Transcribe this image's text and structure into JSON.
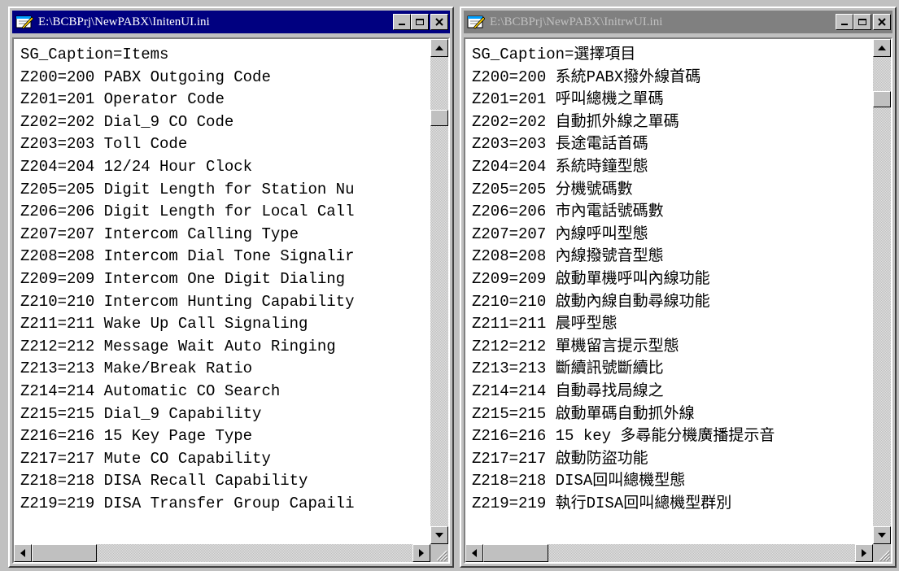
{
  "colors": {
    "active_title": "#000080",
    "inactive_title": "#808080",
    "face": "#c0c0c0"
  },
  "left_window": {
    "title": "E:\\BCBPrj\\NewPABX\\InitenUI.ini",
    "lines": [
      "SG_Caption=Items",
      "Z200=200 PABX Outgoing Code",
      "Z201=201 Operator Code",
      "Z202=202 Dial_9 CO Code",
      "Z203=203 Toll Code",
      "Z204=204 12/24 Hour Clock",
      "Z205=205 Digit Length for Station Nu",
      "Z206=206 Digit Length for Local Call",
      "Z207=207 Intercom Calling Type",
      "Z208=208 Intercom Dial Tone Signalir",
      "Z209=209 Intercom One Digit Dialing",
      "Z210=210 Intercom Hunting Capability",
      "Z211=211 Wake Up Call Signaling",
      "Z212=212 Message Wait Auto Ringing",
      "Z213=213 Make/Break Ratio",
      "Z214=214 Automatic CO Search",
      "Z215=215 Dial_9 Capability",
      "Z216=216 15 Key Page Type",
      "Z217=217 Mute CO Capability",
      "Z218=218 DISA Recall Capability",
      "Z219=219 DISA Transfer Group Capaili"
    ]
  },
  "right_window": {
    "title": "E:\\BCBPrj\\NewPABX\\InitrwUI.ini",
    "lines": [
      "SG_Caption=選擇項目",
      "Z200=200 系統PABX撥外線首碼",
      "Z201=201 呼叫總機之單碼",
      "Z202=202 自動抓外線之單碼",
      "Z203=203 長途電話首碼",
      "Z204=204 系統時鐘型態",
      "Z205=205 分機號碼數",
      "Z206=206 市內電話號碼數",
      "Z207=207 內線呼叫型態",
      "Z208=208 內線撥號音型態",
      "Z209=209 啟動單機呼叫內線功能",
      "Z210=210 啟動內線自動尋線功能",
      "Z211=211 晨呼型態",
      "Z212=212 單機留言提示型態",
      "Z213=213 斷續訊號斷續比",
      "Z214=214 自動尋找局線之",
      "Z215=215 啟動單碼自動抓外線",
      "Z216=216 15 key 多尋能分機廣播提示音",
      "Z217=217 啟動防盜功能",
      "Z218=218 DISA回叫總機型態",
      "Z219=219 執行DISA回叫總機型群別"
    ]
  },
  "icons": {
    "app": "notepad-icon",
    "minimize": "minimize-icon",
    "maximize": "maximize-icon",
    "close": "close-icon",
    "up": "scroll-up-arrow-icon",
    "down": "scroll-down-arrow-icon",
    "left": "scroll-left-arrow-icon",
    "right": "scroll-right-arrow-icon",
    "grip": "size-grip-icon"
  }
}
